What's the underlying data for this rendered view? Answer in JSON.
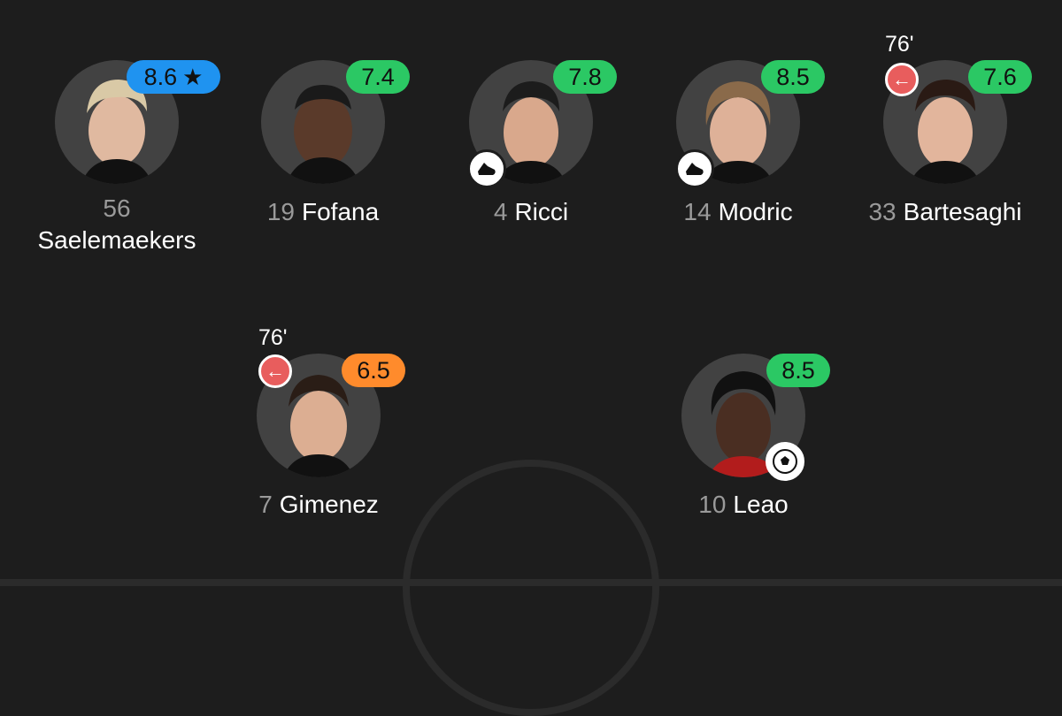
{
  "players": [
    {
      "number": "56",
      "name": "Saelemaekers",
      "rating": "8.6",
      "rating_color": "#1f93f0",
      "motm": true,
      "star_icon": "star-icon"
    },
    {
      "number": "19",
      "name": "Fofana",
      "rating": "7.4",
      "rating_color": "#2bc864"
    },
    {
      "number": "4",
      "name": "Ricci",
      "rating": "7.8",
      "rating_color": "#2bc864",
      "event_icon": "boot-assist-icon"
    },
    {
      "number": "14",
      "name": "Modric",
      "rating": "8.5",
      "rating_color": "#2bc864",
      "event_icon": "boot-assist-icon"
    },
    {
      "number": "33",
      "name": "Bartesaghi",
      "rating": "7.6",
      "rating_color": "#2bc864",
      "sub_minute": "76'",
      "sub_icon": "substitution-out-icon"
    },
    {
      "number": "7",
      "name": "Gimenez",
      "rating": "6.5",
      "rating_color": "#ff8b2c",
      "sub_minute": "76'",
      "sub_icon": "substitution-out-icon"
    },
    {
      "number": "10",
      "name": "Leao",
      "rating": "8.5",
      "rating_color": "#2bc864",
      "event_icon": "football-goal-icon"
    }
  ],
  "icons": {
    "sub_arrow": "←",
    "star": "★"
  }
}
